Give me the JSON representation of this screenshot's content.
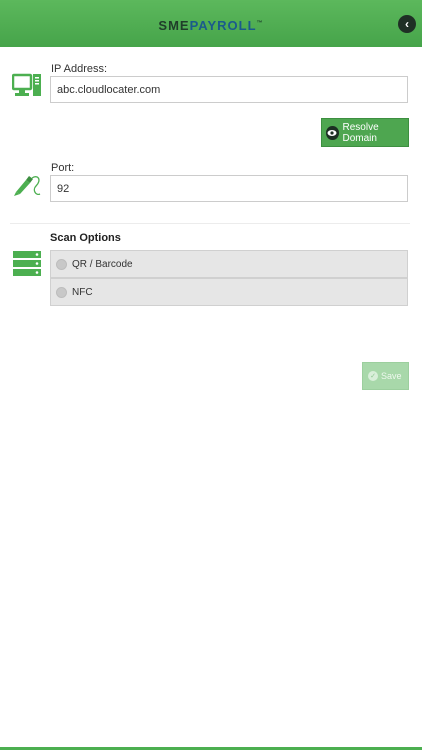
{
  "header": {
    "logo_part1": "SME",
    "logo_part2": "PAYROLL",
    "logo_tm": "™",
    "back_glyph": "‹"
  },
  "ip_address": {
    "label": "IP Address:",
    "value": "abc.cloudlocater.com",
    "icon": "computer-icon"
  },
  "resolve_button": {
    "label": "Resolve Domain",
    "icon": "eye-icon"
  },
  "port": {
    "label": "Port:",
    "value": "92",
    "icon": "pen-icon"
  },
  "scan_options": {
    "title": "Scan Options",
    "icon": "server-icon",
    "options": [
      {
        "label": "QR / Barcode",
        "selected": false
      },
      {
        "label": "NFC",
        "selected": false
      }
    ]
  },
  "save_button": {
    "label": "Save",
    "icon": "check-icon",
    "enabled": false
  },
  "colors": {
    "accent": "#4caf50",
    "button": "#4ea650",
    "disabled_button": "#a8d8aa"
  }
}
